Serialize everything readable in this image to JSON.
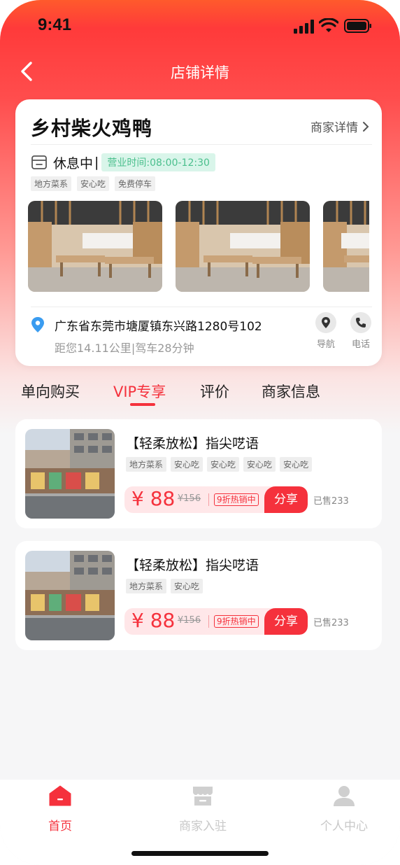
{
  "status_bar": {
    "time": "9:41"
  },
  "nav": {
    "title": "店铺详情",
    "back_icon": "chevron-left-icon"
  },
  "store": {
    "name": "乡村柴火鸡鸭",
    "merchant_link": "商家详情",
    "status": "休息中",
    "status_separator": "|",
    "hours": "营业时间:08:00-12:30",
    "tags": [
      "地方菜系",
      "安心吃",
      "免费停车"
    ],
    "photo_count_visible": 3,
    "address": "广东省东莞市塘厦镇东兴路1280号102",
    "distance": "距您14.11公里",
    "distance_separator": "|",
    "drive_time": "驾车28分钟",
    "actions": {
      "navigate": "导航",
      "phone": "电话"
    }
  },
  "tabs": [
    {
      "label": "单向购买",
      "active": false
    },
    {
      "label": "VIP专享",
      "active": true
    },
    {
      "label": "评价",
      "active": false
    },
    {
      "label": "商家信息",
      "active": false
    }
  ],
  "products": [
    {
      "title": "【轻柔放松】指尖呓语",
      "tags": [
        "地方菜系",
        "安心吃",
        "安心吃",
        "安心吃",
        "安心吃"
      ],
      "price": "¥ 88",
      "old_price": "¥156",
      "promo": "9折热销中",
      "share": "分享",
      "sold": "已售233"
    },
    {
      "title": "【轻柔放松】指尖呓语",
      "tags": [
        "地方菜系",
        "安心吃"
      ],
      "price": "¥ 88",
      "old_price": "¥156",
      "promo": "9折热销中",
      "share": "分享",
      "sold": "已售233"
    }
  ],
  "bottom_nav": [
    {
      "label": "首页",
      "icon": "home-icon",
      "active": true
    },
    {
      "label": "商家入驻",
      "icon": "shop-icon",
      "active": false
    },
    {
      "label": "个人中心",
      "icon": "user-icon",
      "active": false
    }
  ],
  "colors": {
    "accent": "#f5313c",
    "hours_bg": "#d9f5ea",
    "hours_text": "#4bbf8d",
    "pin": "#3a9cf0"
  }
}
